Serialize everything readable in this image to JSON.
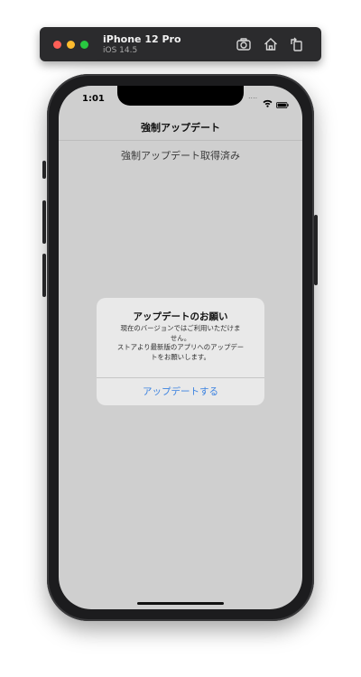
{
  "simulator": {
    "device_name": "iPhone 12 Pro",
    "os_version": "iOS 14.5",
    "buttons": {
      "screenshot_icon": "camera-screenshot-icon",
      "home_icon": "home-icon",
      "rotate_icon": "rotate-icon"
    }
  },
  "status_bar": {
    "time": "1:01",
    "dots": "....",
    "wifi_icon": "wifi-icon",
    "battery_icon": "battery-icon"
  },
  "navigation": {
    "title": "強制アップデート"
  },
  "content": {
    "label": "強制アップデート取得済み"
  },
  "alert": {
    "title": "アップデートのお願い",
    "message": "現在のバージョンではご利用いただけま\nせん。\nストアより最新版のアプリへのアップデー\nトをお願いします。",
    "button_label": "アップデートする"
  },
  "colors": {
    "alert_button": "#3b82e0",
    "screen_dim": "#cfcfcf",
    "alert_background": "#e9e9e9"
  }
}
